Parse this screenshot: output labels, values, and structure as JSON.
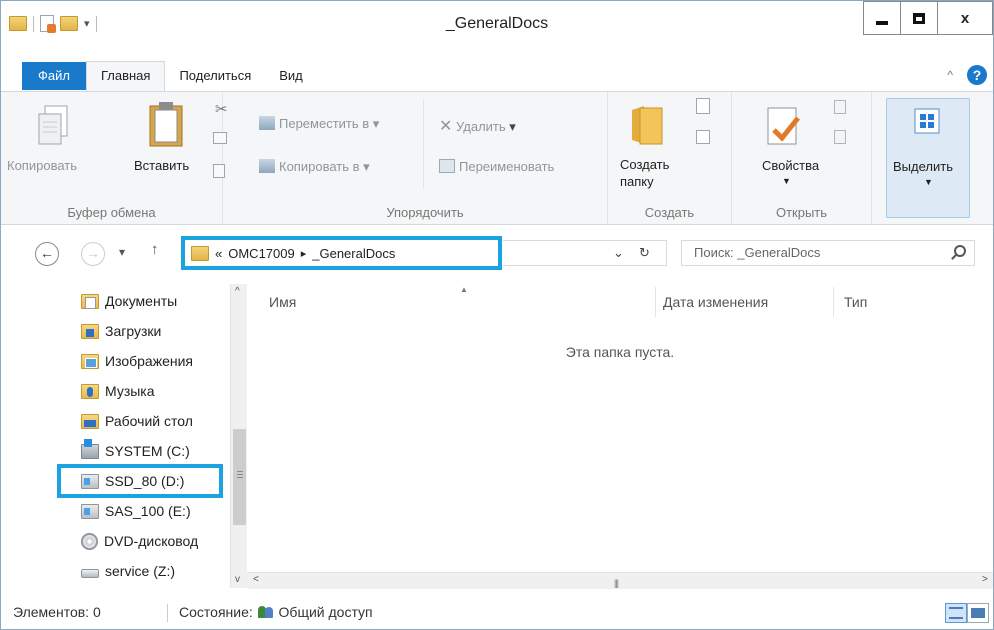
{
  "window": {
    "title": "_GeneralDocs",
    "minimize_label": "",
    "close_label": "x"
  },
  "ribbon_tabs": [
    "Файл",
    "Главная",
    "Поделиться",
    "Вид"
  ],
  "ribbon": {
    "clipboard": {
      "copy": "Копировать",
      "paste": "Вставить",
      "label": "Буфер обмена"
    },
    "organize": {
      "move_to": "Переместить в",
      "copy_to": "Копировать в",
      "delete": "Удалить",
      "rename": "Переименовать",
      "label": "Упорядочить"
    },
    "new": {
      "new_folder_line1": "Создать",
      "new_folder_line2": "папку",
      "label": "Создать"
    },
    "open": {
      "properties": "Свойства",
      "label": "Открыть"
    },
    "select": {
      "select": "Выделить"
    }
  },
  "address": {
    "overflow": "«",
    "crumbs": [
      "OMC17009",
      "_GeneralDocs"
    ],
    "separator": "▸"
  },
  "search": {
    "placeholder": "Поиск: _GeneralDocs"
  },
  "nav_items": [
    {
      "label": "Документы",
      "icon": "documents-icon"
    },
    {
      "label": "Загрузки",
      "icon": "downloads-icon"
    },
    {
      "label": "Изображения",
      "icon": "pictures-icon"
    },
    {
      "label": "Музыка",
      "icon": "music-icon"
    },
    {
      "label": "Рабочий стол",
      "icon": "desktop-icon"
    },
    {
      "label": "SYSTEM (C:)",
      "icon": "system-drive-icon"
    },
    {
      "label": "SSD_80 (D:)",
      "icon": "drive-icon"
    },
    {
      "label": "SAS_100 (E:)",
      "icon": "drive-icon"
    },
    {
      "label": "DVD-дисковод",
      "icon": "dvd-drive-icon"
    },
    {
      "label": "service (Z:)",
      "icon": "network-drive-icon"
    }
  ],
  "columns": {
    "name": "Имя",
    "date": "Дата изменения",
    "type": "Тип"
  },
  "empty_message": "Эта папка пуста.",
  "status": {
    "items": "Элементов: 0",
    "state_label": "Состояние:",
    "state_value": "Общий доступ"
  },
  "colors": {
    "accent": "#1979ca",
    "highlight_box": "#1aa3e0"
  }
}
